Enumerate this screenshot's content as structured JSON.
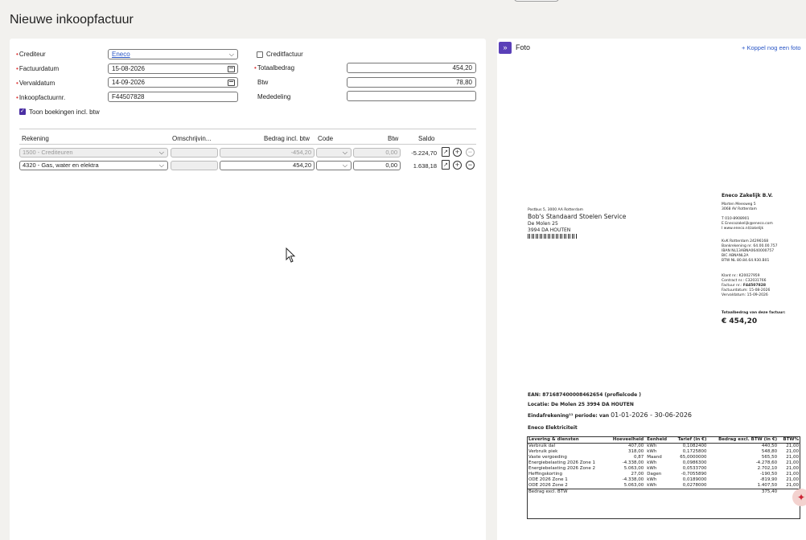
{
  "page": {
    "title": "Nieuwe inkoopfactuur"
  },
  "form": {
    "crediteur": {
      "label": "Crediteur",
      "value": "Eneco"
    },
    "factuurdatum": {
      "label": "Factuurdatum",
      "value": "15-08-2026"
    },
    "vervaldatum": {
      "label": "Vervaldatum",
      "value": "14-09-2026"
    },
    "inkoopfactuurnr": {
      "label": "Inkoopfactuurnr.",
      "value": "F44507828"
    },
    "creditfactuur": {
      "label": "Creditfactuur",
      "checked": false
    },
    "totaalbedrag": {
      "label": "Totaalbedrag",
      "value": "454,20"
    },
    "btw": {
      "label": "Btw",
      "value": "78,80"
    },
    "mededeling": {
      "label": "Mededeling",
      "value": ""
    },
    "toon_boekingen": {
      "label": "Toon boekingen incl. btw",
      "checked": true
    }
  },
  "lines": {
    "headers": [
      "Rekening",
      "Omschrijvin...",
      "Bedrag incl. btw",
      "Code",
      "Btw",
      "Saldo"
    ],
    "rows": [
      {
        "rekening": "1500 - Crediteuren",
        "omschrijving": "",
        "bedrag": "-454,20",
        "code": "",
        "btw": "0,00",
        "saldo": "-5.224,70",
        "disabled": true
      },
      {
        "rekening": "4320 - Gas, water en elektra",
        "omschrijving": "",
        "bedrag": "454,20",
        "code": "",
        "btw": "0,00",
        "saldo": "1.638,18",
        "disabled": false
      }
    ]
  },
  "photo": {
    "title": "Foto",
    "link": "+ Koppel nog een foto"
  },
  "invoice": {
    "sender_line": "Postbus 5, 3000 AA Rotterdam",
    "recipient_name": "Bob's Standaard Stoelen Service",
    "recipient_street": "De Molen 25",
    "recipient_city": "3994 DA HOUTEN",
    "company_name": "Eneco Zakelijk B.V.",
    "company_address_1": "Marten Meesweg 5",
    "company_address_2": "3068 AV Rotterdam",
    "phone": "T 010-8908901",
    "email": "E Enecozakelijk@eneco.com",
    "web": "I www.eneco.nl/zakelijk",
    "kvk": "KvK Rotterdam 24296168",
    "bank": "Bankrekening nr. 64.00.00.757",
    "iban": "IBAN NL13ABNA0640000757",
    "bic": "BIC ABNANL2A",
    "btw_nr": "BTW NL 80.84.64.930.B01",
    "klant_nr": "Klant nr.: K20027959",
    "contract_nr": "Contract nr.: C32031766",
    "factuur_nr_label": "Factuur nr.:",
    "factuur_nr": "F44507828",
    "factuurdatum_label": "Factuurdatum:",
    "factuurdatum": "15-08-2026",
    "vervaldatum_label": "Vervaldatum:",
    "vervaldatum": "15-09-2026",
    "totaal_label": "Totaalbedrag van deze factuur:",
    "totaal": "€ 454,20",
    "ean": "EAN: 871687400008462654 (profielcode )",
    "locatie": "Locatie: De Molen 25 3994 DA HOUTEN",
    "periode_label": "Eindafrekening¹¹ periode: van",
    "periode": "01-01-2026 - 30-06-2026",
    "section": "Eneco Elektriciteit",
    "table_headers": [
      "Levering & diensten",
      "Hoeveelheid",
      "Eenheid",
      "Tarief (in €)",
      "Bedrag excl. BTW (in €)",
      "BTW%"
    ],
    "table_rows": [
      [
        "Verbruik dal",
        "407,00",
        "kWh",
        "0,1082400",
        "440,50",
        "21,00"
      ],
      [
        "Verbruik piek",
        "318,00",
        "kWh",
        "0,1725800",
        "548,80",
        "21,00"
      ],
      [
        "Vaste vergoeding",
        "0,87",
        "Maand",
        "65,0000000",
        "565,50",
        "21,00"
      ],
      [
        "Energiebelasting 2026 Zone 1",
        "-4.338,00",
        "kWh",
        "0,0986300",
        "-4.278,60",
        "21,00"
      ],
      [
        "Energiebelasting 2026 Zone 2",
        "5.063,00",
        "kWh",
        "0,0533700",
        "2.702,10",
        "21,00"
      ],
      [
        "Heffingskorting",
        "27,00",
        "Dagen",
        "-0,7055890",
        "-190,50",
        "21,00"
      ],
      [
        "ODE 2026 Zone 1",
        "-4.338,00",
        "kWh",
        "0,0189000",
        "-819,90",
        "21,00"
      ],
      [
        "ODE 2026 Zone 2",
        "5.063,00",
        "kWh",
        "0,0278000",
        "1.407,50",
        "21,00"
      ]
    ],
    "table_total": [
      "Bedrag excl. BTW",
      "375,40"
    ]
  },
  "colors": {
    "accent": "#5a3fb8",
    "link": "#2a56c6",
    "required": "#dd3333"
  },
  "icons": {
    "expand": "double-chevron-right-icon",
    "attach": "document-icon",
    "add": "plus-circle-icon",
    "remove": "minus-circle-icon",
    "assistant": "sparkle-icon"
  }
}
